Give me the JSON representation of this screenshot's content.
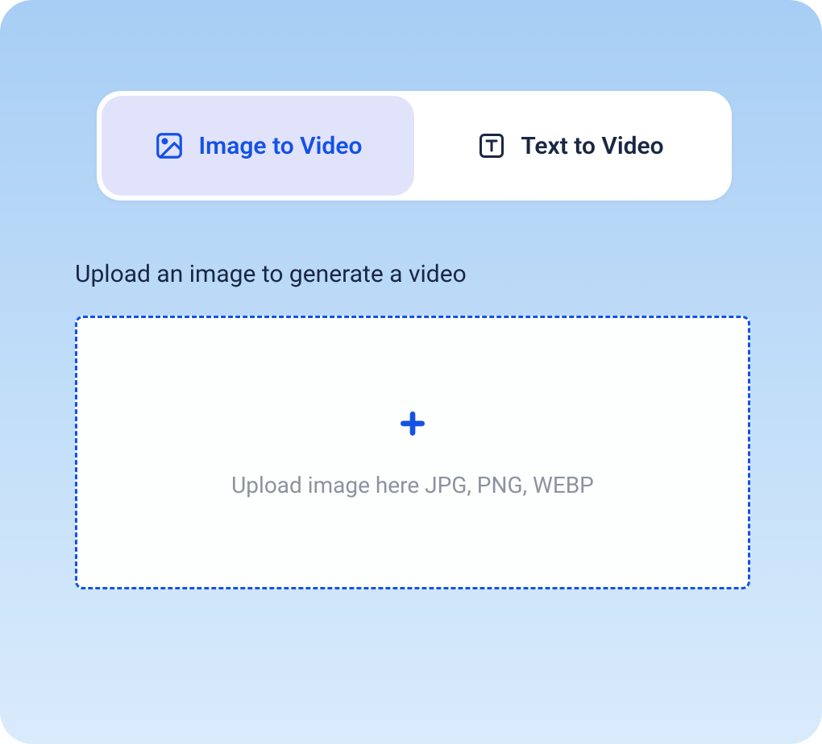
{
  "tabs": {
    "active": {
      "label": "Image to Video",
      "icon": "image-icon"
    },
    "inactive": {
      "label": "Text to Video",
      "icon": "text-icon"
    }
  },
  "upload": {
    "label": "Upload an image to generate a video",
    "hint": "Upload image here JPG, PNG, WEBP"
  },
  "colors": {
    "accent": "#1451e6",
    "activeTabBg": "#e1e3fb",
    "textDark": "#192743",
    "textMuted": "#8c939f"
  }
}
